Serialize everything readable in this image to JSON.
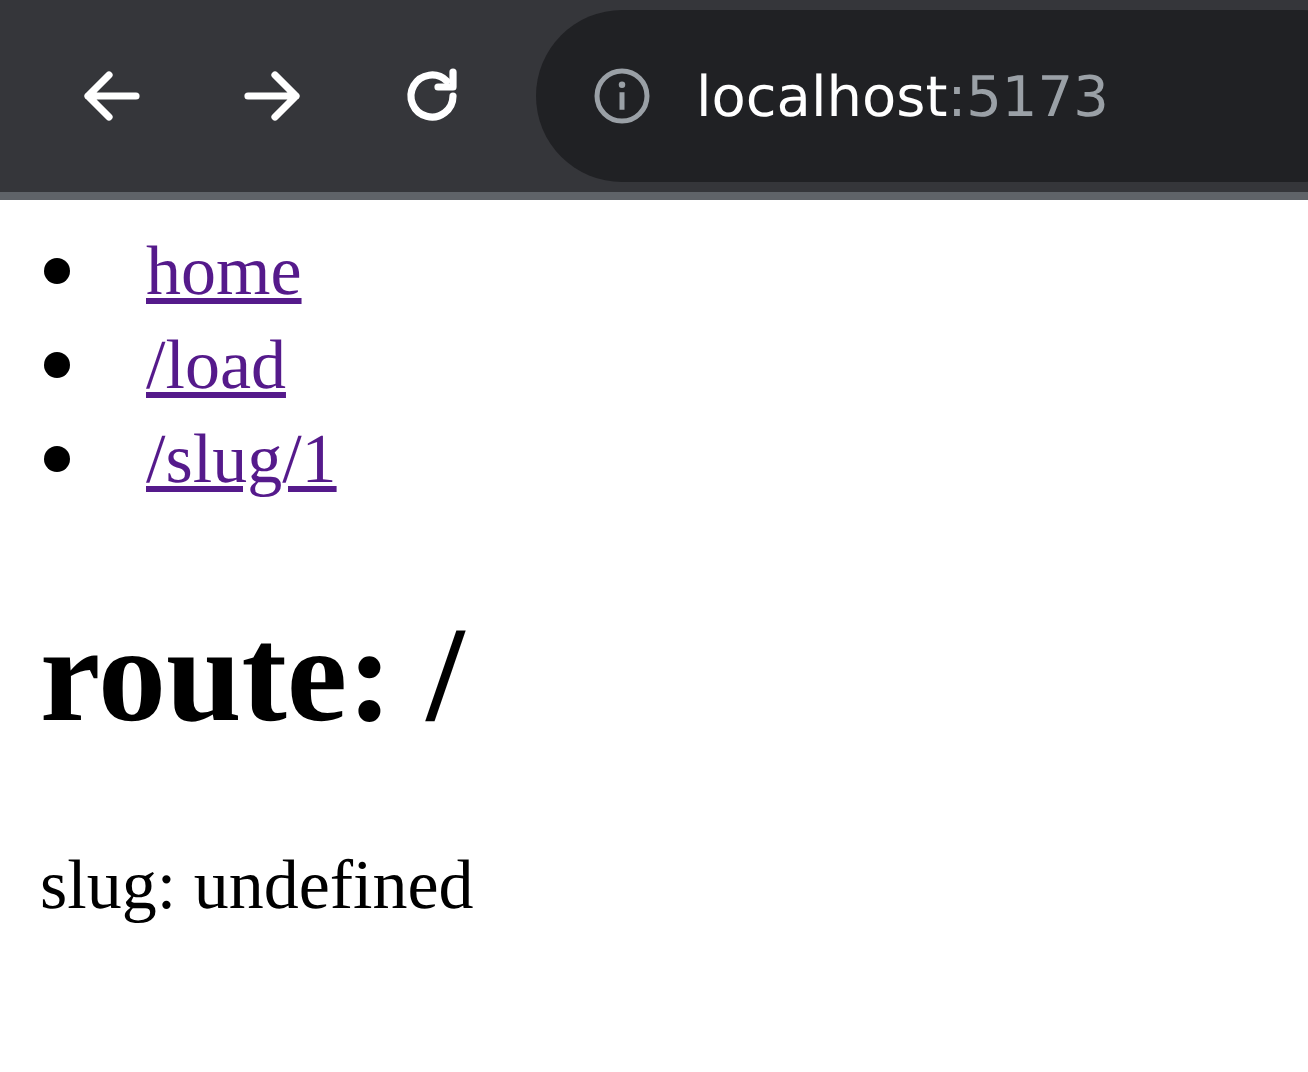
{
  "browser": {
    "host": "localhost",
    "port": ":5173"
  },
  "nav_links": [
    {
      "label": "home",
      "visited": true
    },
    {
      "label": "/load",
      "visited": true
    },
    {
      "label": "/slug/1",
      "visited": true
    }
  ],
  "heading": "route: /",
  "slug_text": "slug: undefined"
}
